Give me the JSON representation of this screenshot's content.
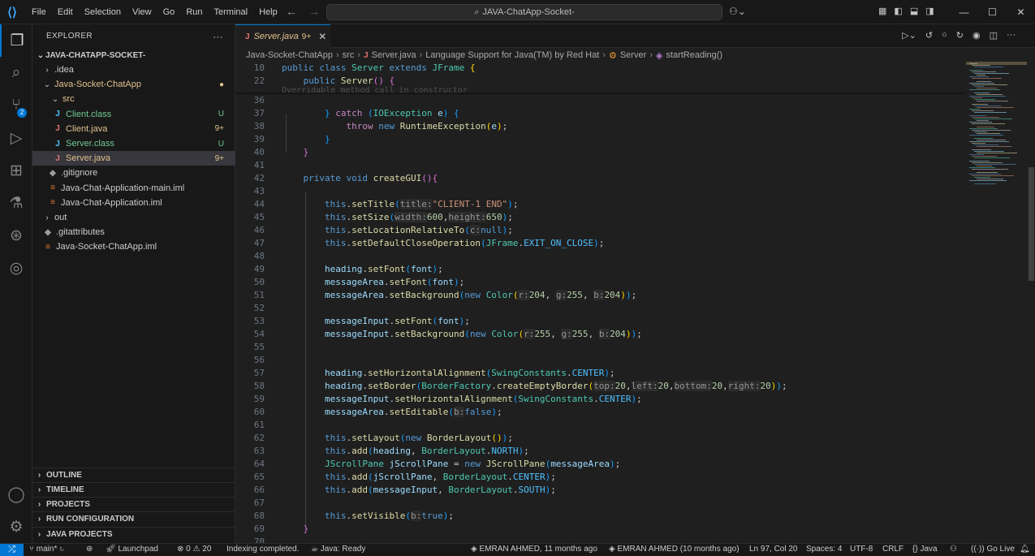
{
  "window": {
    "menu": [
      "File",
      "Edit",
      "Selection",
      "View",
      "Go",
      "Run",
      "Terminal",
      "Help"
    ],
    "search_text": "JAVA-ChatApp-Socket-"
  },
  "colors": {
    "accent": "#0078d4",
    "background": "#1f1f1f",
    "sidebar": "#181818"
  },
  "activity_bar": {
    "items": [
      "explorer-icon",
      "search-icon",
      "source-control-icon",
      "run-debug-icon",
      "extensions-icon",
      "testing-icon",
      "git-graph-icon",
      "docker-icon",
      "account-icon",
      "settings-icon"
    ],
    "scm_badge": "2"
  },
  "sidebar": {
    "title": "EXPLORER",
    "more": "···",
    "root": "JAVA-CHATAPP-SOCKET-",
    "items": [
      {
        "label": ".idea",
        "chev": "›",
        "icon": "",
        "status": ""
      },
      {
        "label": "Java-Socket-ChatApp",
        "chev": "⌄",
        "icon": "",
        "status": "●"
      },
      {
        "label": "src",
        "chev": "⌄",
        "icon": "",
        "status": ""
      },
      {
        "label": "Client.class",
        "chev": "",
        "icon": "J",
        "status": "U"
      },
      {
        "label": "Client.java",
        "chev": "",
        "icon": "J",
        "status": "9+"
      },
      {
        "label": "Server.class",
        "chev": "",
        "icon": "J",
        "status": "U"
      },
      {
        "label": "Server.java",
        "chev": "",
        "icon": "J",
        "status": "9+"
      },
      {
        "label": ".gitignore",
        "chev": "",
        "icon": "◆",
        "status": ""
      },
      {
        "label": "Java-Chat-Application-main.iml",
        "chev": "",
        "icon": "≡",
        "status": ""
      },
      {
        "label": "Java-Chat-Application.iml",
        "chev": "",
        "icon": "≡",
        "status": ""
      },
      {
        "label": "out",
        "chev": "›",
        "icon": "",
        "status": ""
      },
      {
        "label": ".gitattributes",
        "chev": "",
        "icon": "◆",
        "status": ""
      },
      {
        "label": "Java-Socket-ChatApp.iml",
        "chev": "",
        "icon": "≡",
        "status": ""
      }
    ],
    "sections": [
      "OUTLINE",
      "TIMELINE",
      "PROJECTS",
      "RUN CONFIGURATION",
      "JAVA PROJECTS"
    ]
  },
  "editor": {
    "tab": {
      "label": "Server.java",
      "count": "9+",
      "icon": "J",
      "close": "✕"
    },
    "breadcrumb": [
      "Java-Socket-ChatApp",
      "src",
      "Server.java",
      "Language Support for Java(TM) by Red Hat",
      "Server",
      "startReading()"
    ],
    "line_numbers": [
      "10",
      "22",
      "36",
      "37",
      "38",
      "39",
      "40",
      "41",
      "42",
      "43",
      "44",
      "45",
      "46",
      "47",
      "48",
      "49",
      "50",
      "51",
      "52",
      "53",
      "54",
      "55",
      "56",
      "57",
      "58",
      "59",
      "60",
      "61",
      "62",
      "63",
      "64",
      "65",
      "66",
      "67",
      "68",
      "69",
      "70"
    ],
    "warning_text": "Overridable method call in constructor"
  },
  "statusbar": {
    "remote": "⤮",
    "branch": "main*",
    "launchpad": "Launchpad",
    "errors": "0",
    "warnings": "20",
    "indexing": "Indexing completed.",
    "java_status": "Java: Ready",
    "blame": "EMRAN AHMED, 11 months ago",
    "author": "EMRAN AHMED (10 months ago)",
    "position": "Ln 97, Col 20",
    "spaces": "Spaces: 4",
    "encoding": "UTF-8",
    "eol": "CRLF",
    "language": "Java",
    "golive": "Go Live"
  }
}
